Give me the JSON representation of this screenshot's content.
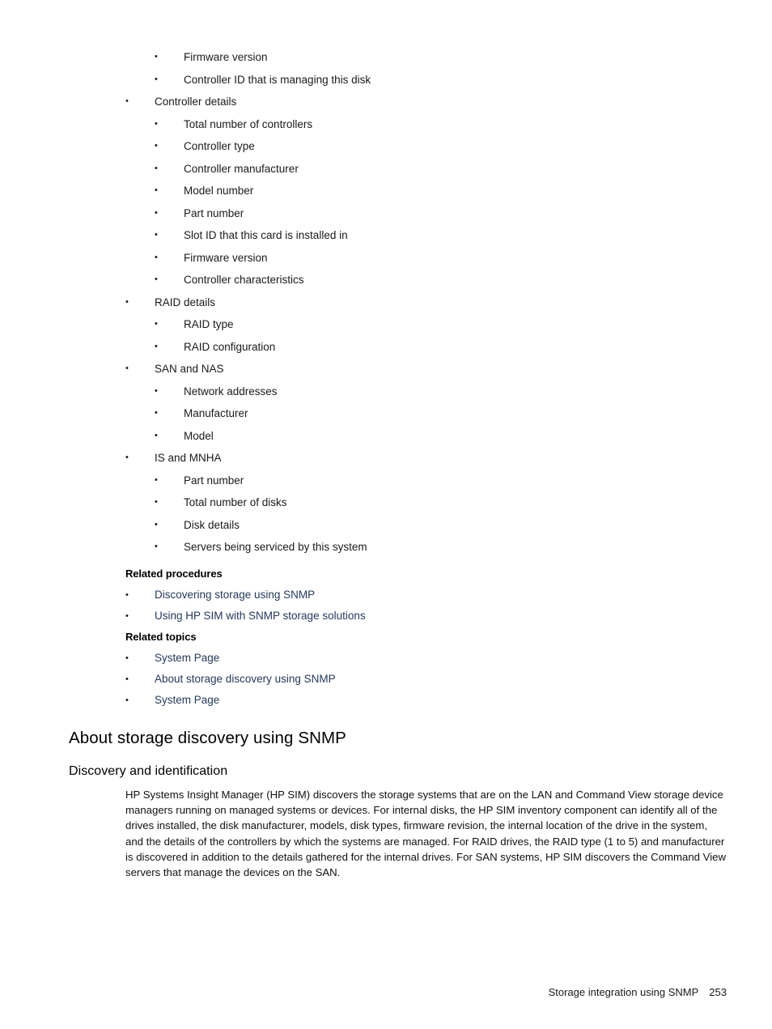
{
  "document": {
    "bullet_glyph": "•",
    "link_color": "#23395b"
  },
  "outline": [
    {
      "level": 2,
      "text": "Firmware version"
    },
    {
      "level": 2,
      "text": "Controller ID that is managing this disk"
    },
    {
      "level": 1,
      "text": "Controller details"
    },
    {
      "level": 2,
      "text": "Total number of controllers"
    },
    {
      "level": 2,
      "text": "Controller type"
    },
    {
      "level": 2,
      "text": "Controller manufacturer"
    },
    {
      "level": 2,
      "text": "Model number"
    },
    {
      "level": 2,
      "text": "Part number"
    },
    {
      "level": 2,
      "text": "Slot ID that this card is installed in"
    },
    {
      "level": 2,
      "text": "Firmware version"
    },
    {
      "level": 2,
      "text": "Controller characteristics"
    },
    {
      "level": 1,
      "text": "RAID details"
    },
    {
      "level": 2,
      "text": "RAID type"
    },
    {
      "level": 2,
      "text": "RAID configuration"
    },
    {
      "level": 1,
      "text": "SAN and NAS"
    },
    {
      "level": 2,
      "text": "Network addresses"
    },
    {
      "level": 2,
      "text": "Manufacturer"
    },
    {
      "level": 2,
      "text": "Model"
    },
    {
      "level": 1,
      "text": "IS and MNHA"
    },
    {
      "level": 2,
      "text": "Part number"
    },
    {
      "level": 2,
      "text": "Total number of disks"
    },
    {
      "level": 2,
      "text": "Disk details"
    },
    {
      "level": 2,
      "text": "Servers being serviced by this system"
    }
  ],
  "related_procedures": {
    "heading": "Related procedures",
    "links": [
      "Discovering storage using SNMP",
      "Using HP SIM with SNMP storage solutions"
    ]
  },
  "related_topics": {
    "heading": "Related topics",
    "links": [
      "System Page",
      "About storage discovery using SNMP",
      "System Page"
    ]
  },
  "section": {
    "title": "About storage discovery using SNMP",
    "subtitle": "Discovery and identification",
    "paragraph": "HP Systems Insight Manager (HP SIM) discovers the storage systems that are on the LAN and Command View storage device managers running on managed systems or devices. For internal disks, the HP SIM inventory component can identify all of the drives installed, the disk manufacturer, models, disk types, firmware revision, the internal location of the drive in the system, and the details of the controllers by which the systems are managed. For RAID drives, the RAID type (1 to 5) and manufacturer is discovered in addition to the details gathered for the internal drives. For SAN systems, HP SIM discovers the Command View servers that manage the devices on the SAN."
  },
  "footer": {
    "chapter": "Storage integration using SNMP",
    "page_number": "253"
  }
}
